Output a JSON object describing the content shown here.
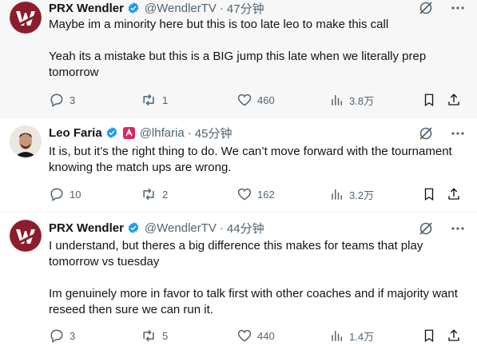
{
  "tweets": [
    {
      "author": "PRX Wendler",
      "handle": "@WendlerTV",
      "separator": "·",
      "time": "47分钟",
      "paragraphs": [
        "Maybe im a minority here but this is too late leo to make this call",
        "Yeah its a mistake but this is a BIG jump this late when we literally prep tomorrow"
      ],
      "replies": "3",
      "retweets": "1",
      "likes": "460",
      "views": "3.8万"
    },
    {
      "author": "Leo Faria",
      "handle": "@lhfaria",
      "separator": "·",
      "time": "45分钟",
      "paragraphs": [
        "It is, but it’s the right thing to do. We can’t move forward with the tournament knowing the match ups are wrong."
      ],
      "replies": "10",
      "retweets": "2",
      "likes": "162",
      "views": "3.2万"
    },
    {
      "author": "PRX Wendler",
      "handle": "@WendlerTV",
      "separator": "·",
      "time": "44分钟",
      "paragraphs": [
        "I understand, but theres a big difference this makes for teams that play tomorrow vs tuesday",
        "Im genuinely more in favor to talk first with other coaches and if majority want reseed then sure we can run it."
      ],
      "replies": "3",
      "retweets": "5",
      "likes": "440",
      "views": "1.4万"
    }
  ],
  "colors": {
    "verified": "#1d9bf0",
    "prx_avatar": "#8b1d2c",
    "secondary_text": "#536471",
    "highlight_bg": "#f7f7f7"
  },
  "icons": [
    "grok-icon",
    "more-icon",
    "reply-icon",
    "retweet-icon",
    "like-icon",
    "views-icon",
    "bookmark-icon",
    "share-icon"
  ]
}
